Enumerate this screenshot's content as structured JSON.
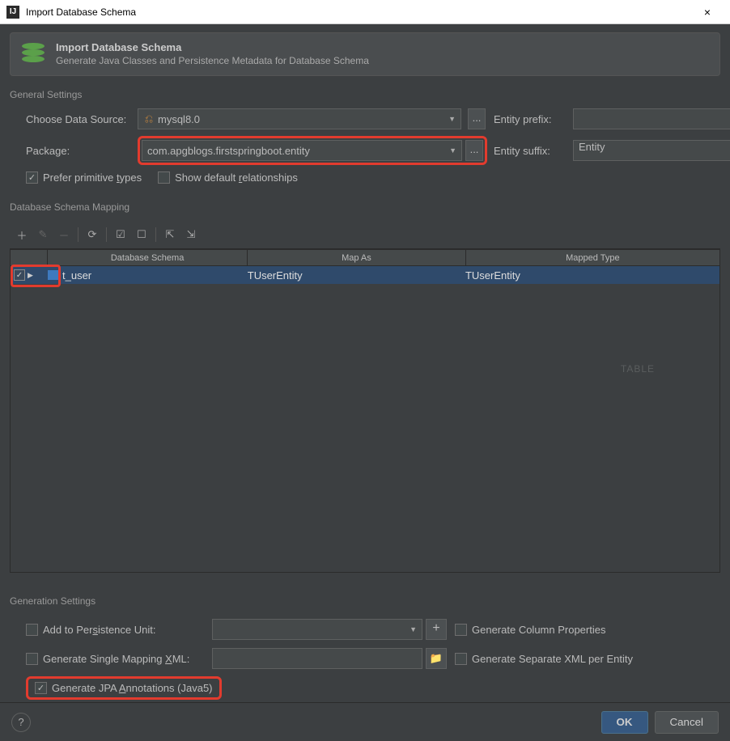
{
  "window": {
    "title": "Import Database Schema",
    "close": "×"
  },
  "banner": {
    "title": "Import Database Schema",
    "subtitle": "Generate Java Classes and Persistence Metadata for Database Schema"
  },
  "general": {
    "section_label": "General Settings",
    "data_source_label": "Choose Data Source:",
    "data_source_value": "mysql8.0",
    "package_label": "Package:",
    "package_value": "com.apgblogs.firstspringboot.entity",
    "entity_prefix_label": "Entity prefix:",
    "entity_prefix_value": "",
    "entity_suffix_label": "Entity suffix:",
    "entity_suffix_value": "Entity",
    "prefer_primitive_label": "Prefer primitive types",
    "prefer_primitive_checked": true,
    "show_default_rel_label": "Show default relationships",
    "show_default_rel_checked": false,
    "dots": "..."
  },
  "schema": {
    "section_label": "Database Schema Mapping",
    "columns": {
      "c1": "Database Schema",
      "c2": "Map As",
      "c3": "Mapped Type"
    },
    "rows": [
      {
        "checked": true,
        "name": "t_user",
        "map_as": "TUserEntity",
        "mapped_type": "TUserEntity"
      }
    ],
    "watermark": "TABLE"
  },
  "generation": {
    "section_label": "Generation Settings",
    "add_persistence_label": "Add to Persistence Unit:",
    "add_persistence_checked": false,
    "gen_column_props_label": "Generate Column Properties",
    "gen_column_props_checked": false,
    "single_mapping_label": "Generate Single Mapping XML:",
    "single_mapping_checked": false,
    "separate_xml_label": "Generate Separate XML per Entity",
    "separate_xml_checked": false,
    "jpa_label": "Generate JPA Annotations (Java5)",
    "jpa_checked": true
  },
  "footer": {
    "help": "?",
    "ok": "OK",
    "cancel": "Cancel"
  },
  "icons": {
    "plus": "+",
    "folder": "📁",
    "arrow_down": "▼",
    "expand": "▶"
  }
}
